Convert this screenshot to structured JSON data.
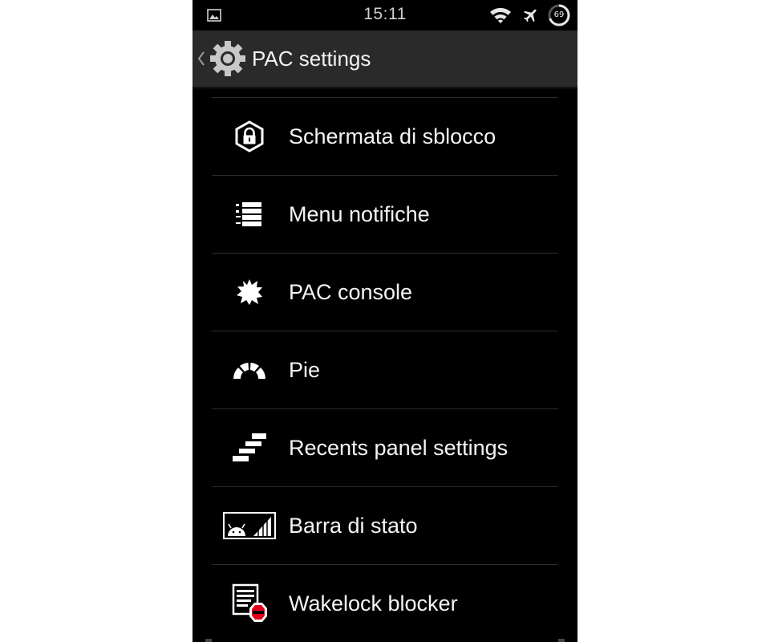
{
  "status_bar": {
    "time": "15:11",
    "battery_level": "69",
    "icons": [
      "image-notification-icon",
      "wifi-icon",
      "airplane-mode-icon",
      "battery-circle-icon"
    ]
  },
  "action_bar": {
    "title": "PAC settings",
    "icons": [
      "back-chevron-icon",
      "settings-gear-icon"
    ]
  },
  "menu": {
    "items": [
      {
        "label": "Schermata di sblocco",
        "icon": "lock-hexagon-icon"
      },
      {
        "label": "Menu notifiche",
        "icon": "notification-list-icon"
      },
      {
        "label": "PAC console",
        "icon": "pac-splat-icon"
      },
      {
        "label": "Pie",
        "icon": "pie-arc-icon"
      },
      {
        "label": "Recents panel settings",
        "icon": "recents-stairs-icon"
      },
      {
        "label": "Barra di stato",
        "icon": "status-bar-android-icon"
      },
      {
        "label": "Wakelock blocker",
        "icon": "wakelock-blocker-icon"
      }
    ]
  },
  "colors": {
    "background": "#000000",
    "action_bar": "#2a2a2a",
    "divider": "#2c2c2c",
    "text": "#f4f4f4",
    "accent_red": "#e0001b"
  }
}
